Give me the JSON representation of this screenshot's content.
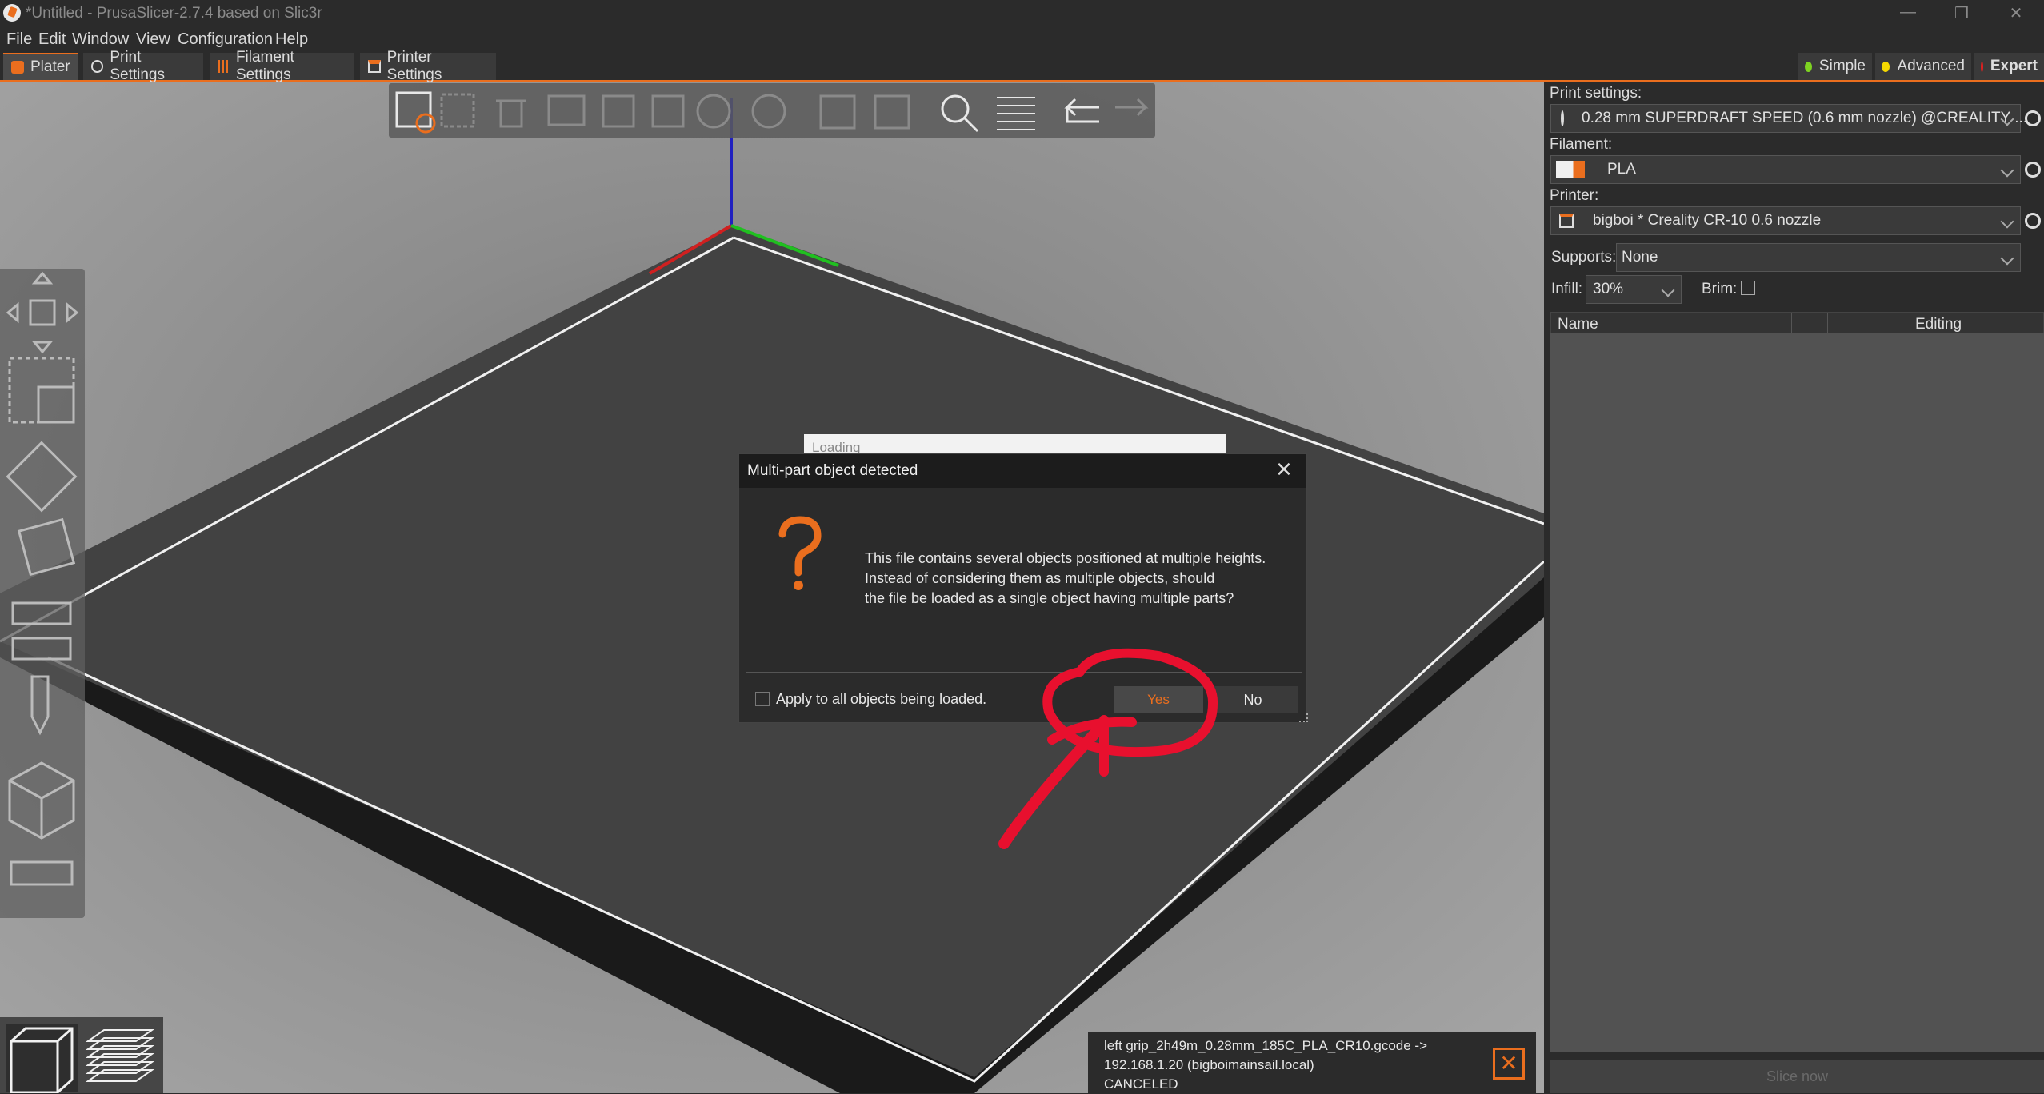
{
  "window": {
    "title": "*Untitled - PrusaSlicer-2.7.4 based on Slic3r",
    "controls": [
      "minimize-icon",
      "restore-icon",
      "close-icon"
    ]
  },
  "menu": {
    "items": [
      "File",
      "Edit",
      "Window",
      "View",
      "Configuration",
      "Help"
    ]
  },
  "tabs": {
    "plater": "Plater",
    "print_settings": "Print Settings",
    "filament_settings": "Filament Settings",
    "printer_settings": "Printer Settings"
  },
  "modes": {
    "simple": "Simple",
    "advanced": "Advanced",
    "expert": "Expert",
    "colors": {
      "simple": "#7ed321",
      "advanced": "#f5d800",
      "expert": "#e02020"
    }
  },
  "sidebar": {
    "print_label": "Print settings:",
    "print_value": "0.28 mm SUPERDRAFT SPEED (0.6 mm nozzle) @CREALITY ...",
    "filament_label": "Filament:",
    "filament_value": "PLA",
    "printer_label": "Printer:",
    "printer_value": "bigboi * Creality CR-10 0.6 nozzle",
    "supports_label": "Supports:",
    "supports_value": "None",
    "infill_label": "Infill:",
    "infill_value": "30%",
    "brim_label": "Brim:",
    "list_name_header": "Name",
    "list_editing_header": "Editing",
    "slice_button": "Slice now"
  },
  "loading": {
    "text": "Loading"
  },
  "dialog": {
    "title": "Multi-part object detected",
    "message_line1": "This file contains several objects positioned at multiple heights.",
    "message_line2": "Instead of considering them as multiple objects, should",
    "message_line3": "the file be loaded as a single object having multiple parts?",
    "checkbox_label": "Apply to all objects being loaded.",
    "yes_label": "Yes",
    "no_label": "No",
    "question_icon": "question-icon"
  },
  "notification": {
    "line1": "left grip_2h49m_0.28mm_185C_PLA_CR10.gcode ->",
    "line2": "192.168.1.20 (bigboimainsail.local)",
    "line3": "CANCELED"
  },
  "colors": {
    "accent": "#ea6e1e",
    "annotation_red": "#e8102e"
  }
}
